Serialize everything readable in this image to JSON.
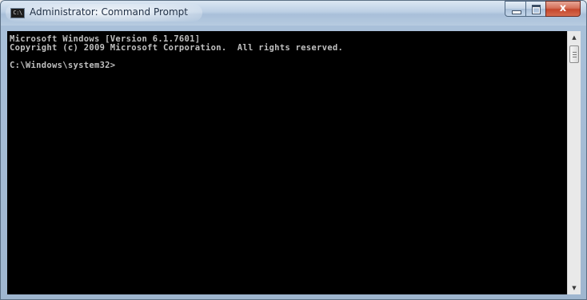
{
  "window": {
    "title": "Administrator: Command Prompt",
    "icon_text": "C:\\",
    "controls": {
      "minimize": "minimize-icon",
      "maximize": "maximize-icon",
      "close": "close-icon",
      "close_glyph": "x"
    }
  },
  "console": {
    "lines": [
      "Microsoft Windows [Version 6.1.7601]",
      "Copyright (c) 2009 Microsoft Corporation.  All rights reserved.",
      "",
      "C:\\Windows\\system32>"
    ],
    "text_color": "#c0c0c0",
    "background": "#000000"
  },
  "scrollbar": {
    "up_glyph": "▲",
    "down_glyph": "▼"
  }
}
